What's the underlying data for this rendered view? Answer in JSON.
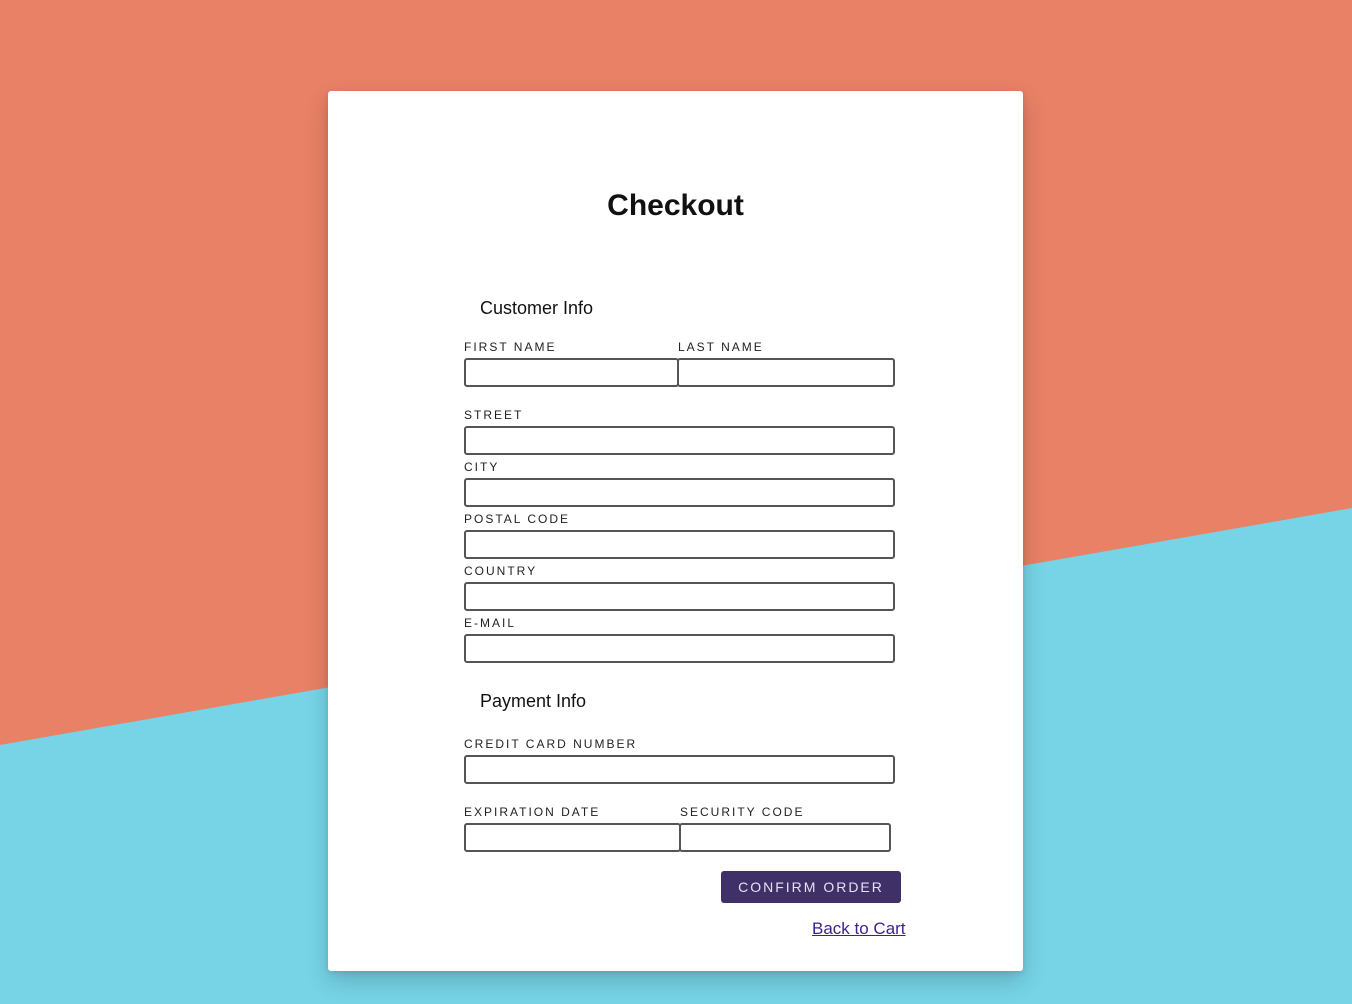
{
  "colors": {
    "background_top": "#e88166",
    "background_bottom": "#76d4e6",
    "card": "#ffffff",
    "button": "#3f3068",
    "link": "#3f1f8a"
  },
  "page_title": "Checkout",
  "customer_info": {
    "heading": "Customer Info",
    "first_name": {
      "label": "First Name",
      "value": ""
    },
    "last_name": {
      "label": "Last Name",
      "value": ""
    },
    "street": {
      "label": "Street",
      "value": ""
    },
    "city": {
      "label": "City",
      "value": ""
    },
    "postal_code": {
      "label": "Postal Code",
      "value": ""
    },
    "country": {
      "label": "Country",
      "value": ""
    },
    "email": {
      "label": "E-mail",
      "value": ""
    }
  },
  "payment_info": {
    "heading": "Payment Info",
    "credit_card_number": {
      "label": "Credit Card Number",
      "value": ""
    },
    "expiration_date": {
      "label": "Expiration Date",
      "value": ""
    },
    "security_code": {
      "label": "Security Code",
      "value": ""
    }
  },
  "actions": {
    "confirm_label": "Confirm Order",
    "back_link_label": "Back to Cart"
  }
}
